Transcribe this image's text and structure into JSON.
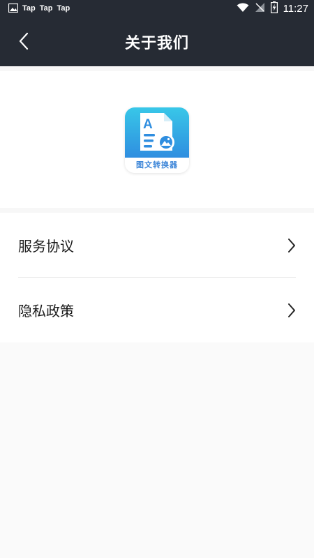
{
  "status_bar": {
    "notifications": [
      "Tap",
      "Tap",
      "Tap"
    ],
    "time": "11:27",
    "icons": [
      "image-icon",
      "wifi-icon",
      "no-signal-icon",
      "battery-charging-icon"
    ]
  },
  "header": {
    "title": "关于我们",
    "back_icon": "chevron-left-icon"
  },
  "app": {
    "icon_label": "图文转换器",
    "icon_colors": {
      "top": "#38c7e8",
      "bottom": "#2f8ee0",
      "label": "#3d86d8"
    }
  },
  "menu": {
    "items": [
      {
        "label": "服务协议",
        "icon": "chevron-right-icon"
      },
      {
        "label": "隐私政策",
        "icon": "chevron-right-icon"
      }
    ]
  },
  "colors": {
    "header_bg": "#262b34",
    "page_bg": "#f7f7f7",
    "card_bg": "#ffffff",
    "text": "#1a1a1a"
  }
}
